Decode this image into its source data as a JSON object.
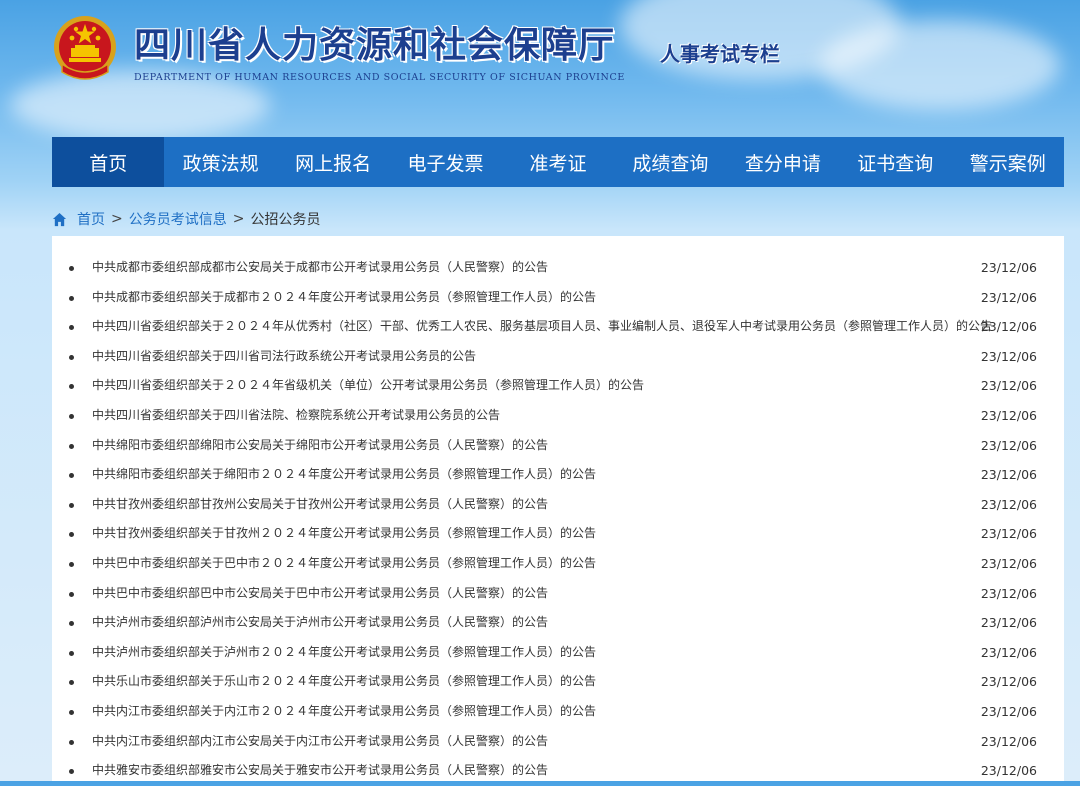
{
  "header": {
    "title": "四川省人力资源和社会保障厅",
    "subtitle": "DEPARTMENT OF HUMAN RESOURCES AND SOCIAL SECURITY OF SICHUAN PROVINCE",
    "section": "人事考试专栏"
  },
  "nav": {
    "items": [
      {
        "label": "首页",
        "active": true
      },
      {
        "label": "政策法规"
      },
      {
        "label": "网上报名"
      },
      {
        "label": "电子发票"
      },
      {
        "label": "准考证"
      },
      {
        "label": "成绩查询"
      },
      {
        "label": "查分申请"
      },
      {
        "label": "证书查询"
      },
      {
        "label": "警示案例"
      }
    ]
  },
  "breadcrumb": {
    "home": "首页",
    "sep": ">",
    "level1": "公务员考试信息",
    "current": "公招公务员"
  },
  "announcements": [
    {
      "title": "中共成都市委组织部成都市公安局关于成都市公开考试录用公务员（人民警察）的公告",
      "date": "23/12/06"
    },
    {
      "title": "中共成都市委组织部关于成都市２０２４年度公开考试录用公务员（参照管理工作人员）的公告",
      "date": "23/12/06"
    },
    {
      "title": "中共四川省委组织部关于２０２４年从优秀村（社区）干部、优秀工人农民、服务基层项目人员、事业编制人员、退役军人中考试录用公务员（参照管理工作人员）的公告",
      "date": "23/12/06"
    },
    {
      "title": "中共四川省委组织部关于四川省司法行政系统公开考试录用公务员的公告",
      "date": "23/12/06"
    },
    {
      "title": "中共四川省委组织部关于２０２４年省级机关（单位）公开考试录用公务员（参照管理工作人员）的公告",
      "date": "23/12/06"
    },
    {
      "title": "中共四川省委组织部关于四川省法院、检察院系统公开考试录用公务员的公告",
      "date": "23/12/06"
    },
    {
      "title": "中共绵阳市委组织部绵阳市公安局关于绵阳市公开考试录用公务员（人民警察）的公告",
      "date": "23/12/06"
    },
    {
      "title": "中共绵阳市委组织部关于绵阳市２０２４年度公开考试录用公务员（参照管理工作人员）的公告",
      "date": "23/12/06"
    },
    {
      "title": "中共甘孜州委组织部甘孜州公安局关于甘孜州公开考试录用公务员（人民警察）的公告",
      "date": "23/12/06"
    },
    {
      "title": "中共甘孜州委组织部关于甘孜州２０２４年度公开考试录用公务员（参照管理工作人员）的公告",
      "date": "23/12/06"
    },
    {
      "title": "中共巴中市委组织部关于巴中市２０２４年度公开考试录用公务员（参照管理工作人员）的公告",
      "date": "23/12/06"
    },
    {
      "title": "中共巴中市委组织部巴中市公安局关于巴中市公开考试录用公务员（人民警察）的公告",
      "date": "23/12/06"
    },
    {
      "title": "中共泸州市委组织部泸州市公安局关于泸州市公开考试录用公务员（人民警察）的公告",
      "date": "23/12/06"
    },
    {
      "title": "中共泸州市委组织部关于泸州市２０２４年度公开考试录用公务员（参照管理工作人员）的公告",
      "date": "23/12/06"
    },
    {
      "title": "中共乐山市委组织部关于乐山市２０２４年度公开考试录用公务员（参照管理工作人员）的公告",
      "date": "23/12/06"
    },
    {
      "title": "中共内江市委组织部关于内江市２０２４年度公开考试录用公务员（参照管理工作人员）的公告",
      "date": "23/12/06"
    },
    {
      "title": "中共内江市委组织部内江市公安局关于内江市公开考试录用公务员（人民警察）的公告",
      "date": "23/12/06"
    },
    {
      "title": "中共雅安市委组织部雅安市公安局关于雅安市公开考试录用公务员（人民警察）的公告",
      "date": "23/12/06"
    }
  ],
  "icons": {
    "emblem": "national-emblem-icon",
    "home": "home-icon"
  },
  "colors": {
    "nav_bg": "#1d6fc4",
    "nav_active": "#0d4f9d",
    "title": "#1c3f8f",
    "link": "#1f6fc4"
  }
}
